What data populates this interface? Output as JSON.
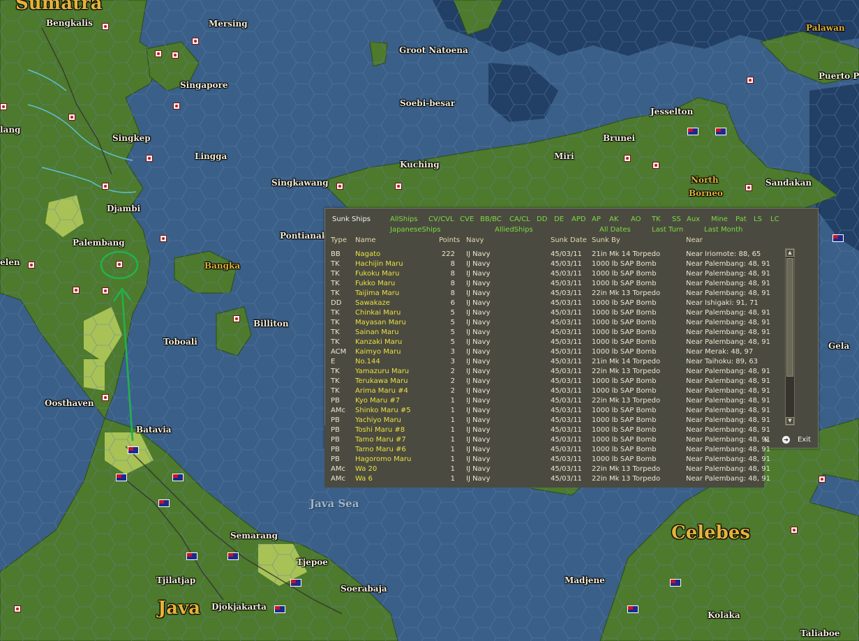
{
  "map": {
    "places": [
      {
        "label": "Sumatra",
        "kind": "region"
      },
      {
        "label": "Bengkalis",
        "kind": "town"
      },
      {
        "label": "Mersing",
        "kind": "town"
      },
      {
        "label": "Groot Natoena",
        "kind": "town"
      },
      {
        "label": "Palawan",
        "kind": "island"
      },
      {
        "label": "Puerto P",
        "kind": "town"
      },
      {
        "label": "Singapore",
        "kind": "town"
      },
      {
        "label": "Soebi-besar",
        "kind": "town"
      },
      {
        "label": "Jesselton",
        "kind": "town"
      },
      {
        "label": "lang",
        "kind": "town"
      },
      {
        "label": "Singkep",
        "kind": "town"
      },
      {
        "label": "Brunei",
        "kind": "town"
      },
      {
        "label": "Lingga",
        "kind": "town"
      },
      {
        "label": "Miri",
        "kind": "town"
      },
      {
        "label": "Kuching",
        "kind": "town"
      },
      {
        "label": "Singkawang",
        "kind": "town"
      },
      {
        "label": "North",
        "kind": "island"
      },
      {
        "label": "Borneo",
        "kind": "island"
      },
      {
        "label": "Sandakan",
        "kind": "town"
      },
      {
        "label": "Djambi",
        "kind": "town"
      },
      {
        "label": "Pontianak",
        "kind": "town"
      },
      {
        "label": "Palembang",
        "kind": "town"
      },
      {
        "label": "elen",
        "kind": "town"
      },
      {
        "label": "Bangka",
        "kind": "island"
      },
      {
        "label": "Billiton",
        "kind": "town"
      },
      {
        "label": "Toboali",
        "kind": "town"
      },
      {
        "label": "Oosthaven",
        "kind": "town"
      },
      {
        "label": "Batavia",
        "kind": "town"
      },
      {
        "label": "Java Sea",
        "kind": "sea"
      },
      {
        "label": "Celebes",
        "kind": "region"
      },
      {
        "label": "Semarang",
        "kind": "town"
      },
      {
        "label": "Tjepoe",
        "kind": "town"
      },
      {
        "label": "Tjilatjap",
        "kind": "town"
      },
      {
        "label": "Soerabaja",
        "kind": "town"
      },
      {
        "label": "Madjene",
        "kind": "town"
      },
      {
        "label": "Java",
        "kind": "region"
      },
      {
        "label": "Djokjakarta",
        "kind": "town"
      },
      {
        "label": "Kolaka",
        "kind": "town"
      },
      {
        "label": "Taliaboe",
        "kind": "town"
      },
      {
        "label": "Gela",
        "kind": "town"
      }
    ],
    "colors": {
      "sea": "#3a5f88",
      "deep_sea": "#223f66",
      "land": "#4d7a2c",
      "hex_line": "#5f80a8",
      "route_arrow": "#22b14c"
    }
  },
  "dialog": {
    "title": "Sunk Ships",
    "filters_row1": [
      "AllShips",
      "CV/CVL",
      "CVE",
      "BB/BC",
      "CA/CL",
      "DD",
      "DE",
      "APD",
      "AP",
      "AK",
      "AO",
      "TK",
      "SS",
      "Aux",
      "Mine",
      "Pat",
      "LS",
      "LC"
    ],
    "filters_row2": [
      "JapaneseShips",
      "AlliedShips",
      "All Dates",
      "Last Turn",
      "Last Month"
    ],
    "columns": [
      "Type",
      "Name",
      "Points",
      "Navy",
      "Sunk Date",
      "Sunk By",
      "Near"
    ],
    "rows": [
      [
        "BB",
        "Nagato",
        "222",
        "IJ Navy",
        "45/03/11",
        "21in Mk 14 Torpedo",
        "Near Iriomote: 88, 65"
      ],
      [
        "TK",
        "Hachijin Maru",
        "8",
        "IJ Navy",
        "45/03/11",
        "1000 lb SAP Bomb",
        "Near Palembang: 48, 91"
      ],
      [
        "TK",
        "Fukoku Maru",
        "8",
        "IJ Navy",
        "45/03/11",
        "1000 lb SAP Bomb",
        "Near Palembang: 48, 91"
      ],
      [
        "TK",
        "Fukko Maru",
        "8",
        "IJ Navy",
        "45/03/11",
        "1000 lb SAP Bomb",
        "Near Palembang: 48, 91"
      ],
      [
        "TK",
        "Taijima Maru",
        "8",
        "IJ Navy",
        "45/03/11",
        "22in Mk 13 Torpedo",
        "Near Palembang: 48, 91"
      ],
      [
        "DD",
        "Sawakaze",
        "6",
        "IJ Navy",
        "45/03/11",
        "1000 lb SAP Bomb",
        "Near Ishigaki: 91, 71"
      ],
      [
        "TK",
        "Chinkai Maru",
        "5",
        "IJ Navy",
        "45/03/11",
        "1000 lb SAP Bomb",
        "Near Palembang: 48, 91"
      ],
      [
        "TK",
        "Mayasan Maru",
        "5",
        "IJ Navy",
        "45/03/11",
        "1000 lb SAP Bomb",
        "Near Palembang: 48, 91"
      ],
      [
        "TK",
        "Sainan Maru",
        "5",
        "IJ Navy",
        "45/03/11",
        "1000 lb SAP Bomb",
        "Near Palembang: 48, 91"
      ],
      [
        "TK",
        "Kanzaki Maru",
        "5",
        "IJ Navy",
        "45/03/11",
        "1000 lb SAP Bomb",
        "Near Palembang: 48, 91"
      ],
      [
        "ACM",
        "Kaimyo Maru",
        "3",
        "IJ Navy",
        "45/03/11",
        "1000 lb SAP Bomb",
        "Near Merak: 48, 97"
      ],
      [
        "E",
        "No.144",
        "3",
        "IJ Navy",
        "45/03/11",
        "21in Mk 14 Torpedo",
        "Near Taihoku: 89, 63"
      ],
      [
        "TK",
        "Yamazuru Maru",
        "2",
        "IJ Navy",
        "45/03/11",
        "22in Mk 13 Torpedo",
        "Near Palembang: 48, 91"
      ],
      [
        "TK",
        "Terukawa Maru",
        "2",
        "IJ Navy",
        "45/03/11",
        "1000 lb SAP Bomb",
        "Near Palembang: 48, 91"
      ],
      [
        "TK",
        "Arima Maru #4",
        "2",
        "IJ Navy",
        "45/03/11",
        "1000 lb SAP Bomb",
        "Near Palembang: 48, 91"
      ],
      [
        "PB",
        "Kyo Maru #7",
        "1",
        "IJ Navy",
        "45/03/11",
        "22in Mk 13 Torpedo",
        "Near Palembang: 48, 91"
      ],
      [
        "AMc",
        "Shinko Maru #5",
        "1",
        "IJ Navy",
        "45/03/11",
        "1000 lb SAP Bomb",
        "Near Palembang: 48, 91"
      ],
      [
        "PB",
        "Yachiyo Maru",
        "1",
        "IJ Navy",
        "45/03/11",
        "1000 lb SAP Bomb",
        "Near Palembang: 48, 91"
      ],
      [
        "PB",
        "Toshi Maru #8",
        "1",
        "IJ Navy",
        "45/03/11",
        "1000 lb SAP Bomb",
        "Near Palembang: 48, 91"
      ],
      [
        "PB",
        "Tamo Maru #7",
        "1",
        "IJ Navy",
        "45/03/11",
        "1000 lb SAP Bomb",
        "Near Palembang: 48, 91"
      ],
      [
        "PB",
        "Tamo Maru #6",
        "1",
        "IJ Navy",
        "45/03/11",
        "1000 lb SAP Bomb",
        "Near Palembang: 48, 91"
      ],
      [
        "PB",
        "Hagoromo Maru",
        "1",
        "IJ Navy",
        "45/03/11",
        "1000 lb SAP Bomb",
        "Near Palembang: 48, 91"
      ],
      [
        "AMc",
        "Wa 20",
        "1",
        "IJ Navy",
        "45/03/11",
        "22in Mk 13 Torpedo",
        "Near Palembang: 48, 91"
      ],
      [
        "AMc",
        "Wa 6",
        "1",
        "IJ Navy",
        "45/03/11",
        "22in Mk 13 Torpedo",
        "Near Palembang: 48, 91"
      ]
    ],
    "stray_text": "k",
    "exit_label": "Exit",
    "colors": {
      "filter": "#7cdc3e",
      "ship_name": "#e8e040",
      "text": "#ece6d0",
      "panel_bg": "#4b4a40"
    }
  }
}
